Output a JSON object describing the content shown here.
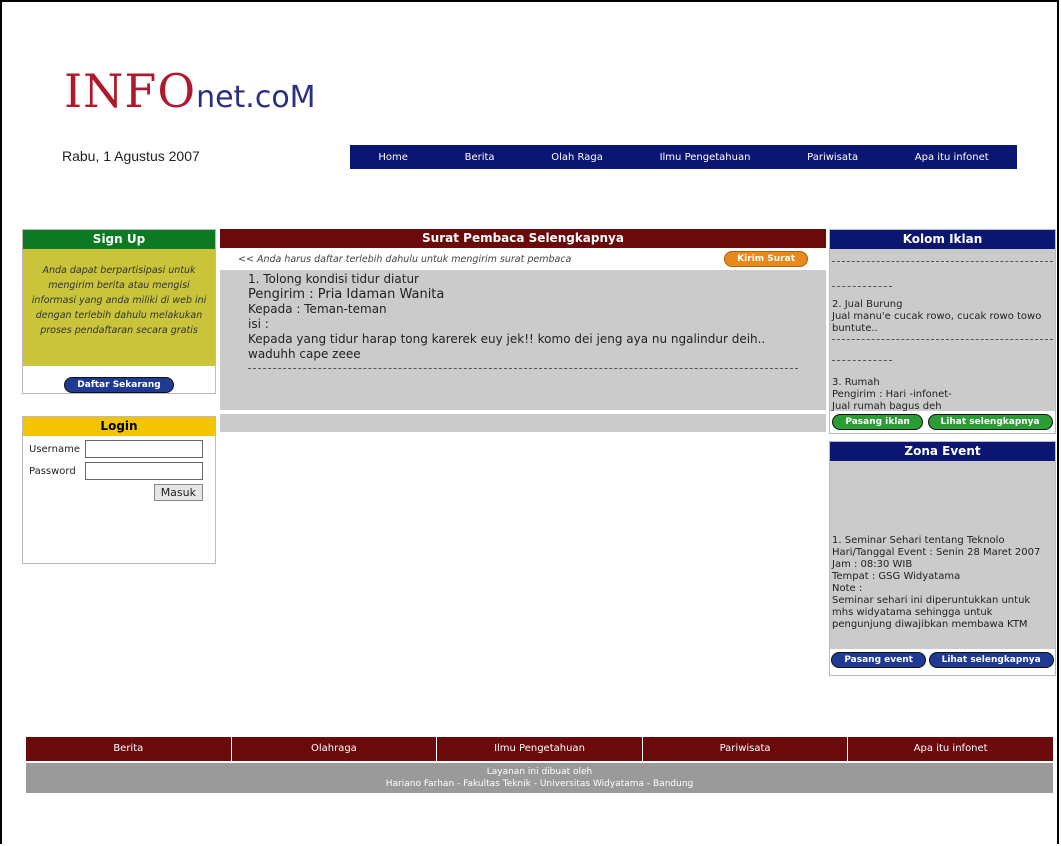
{
  "site": {
    "logo_main": "INFO",
    "logo_sub": "net.coM",
    "date": "Rabu, 1 Agustus 2007"
  },
  "topnav": [
    "Home",
    "Berita",
    "Olah Raga",
    "Ilmu Pengetahuan",
    "Pariwisata",
    "Apa itu infonet"
  ],
  "signup": {
    "title": "Sign Up",
    "text": "Anda dapat berpartisipasi untuk mengirim berita atau mengisi informasi yang anda miliki di web ini dengan terlebih dahulu melakukan proses pendaftaran secara gratis",
    "button": "Daftar Sekarang"
  },
  "login": {
    "title": "Login",
    "username_label": "Username",
    "password_label": "Password",
    "submit": "Masuk"
  },
  "main": {
    "title": "Surat Pembaca Selengkapnya",
    "notice": "<< Anda harus daftar terlebih dahulu untuk mengirim surat pembaca",
    "send_button": "Kirim Surat",
    "letter": {
      "heading": "1. Tolong kondisi tidur diatur",
      "sender": "Pengirim : Pria Idaman Wanita",
      "to": "Kepada : Teman-teman",
      "isi_label": "isi :",
      "body": "Kepada yang tidur harap tong karerek euy jek!! komo dei jeng aya nu ngalindur deih.. waduhh cape zeee"
    }
  },
  "iklan": {
    "title": "Kolom Iklan",
    "item2_title": "2. Jual Burung",
    "item2_text": "Jual manu'e cucak rowo, cucak rowo towo buntute..",
    "item3_title": "3. Rumah",
    "item3_sender": "Pengirim : Hari -infonet-",
    "item3_text": "Jual rumah bagus deh",
    "btn_post": "Pasang iklan",
    "btn_more": "Lihat selengkapnya"
  },
  "event": {
    "title": "Zona Event",
    "line1": "1. Seminar Sehari tentang Teknolo",
    "line2": "Hari/Tanggal Event : Senin 28 Maret 2007",
    "line3": "Jam : 08:30 WIB",
    "line4": "Tempat : GSG Widyatama",
    "line5": "Note :",
    "line6": "Seminar sehari ini diperuntukkan untuk mhs widyatama sehingga untuk pengunjung diwajibkan membawa KTM",
    "btn_post": "Pasang event",
    "btn_more": "Lihat selengkapnya"
  },
  "footer": {
    "nav": [
      "Berita",
      "Olahraga",
      "Ilmu Pengetahuan",
      "Pariwisata",
      "Apa itu infonet"
    ],
    "credit1": "Layanan ini dibuat oleh",
    "credit2": "Hariano Farhan - Fakultas Teknik - Universitas Widyatama - Bandung"
  }
}
